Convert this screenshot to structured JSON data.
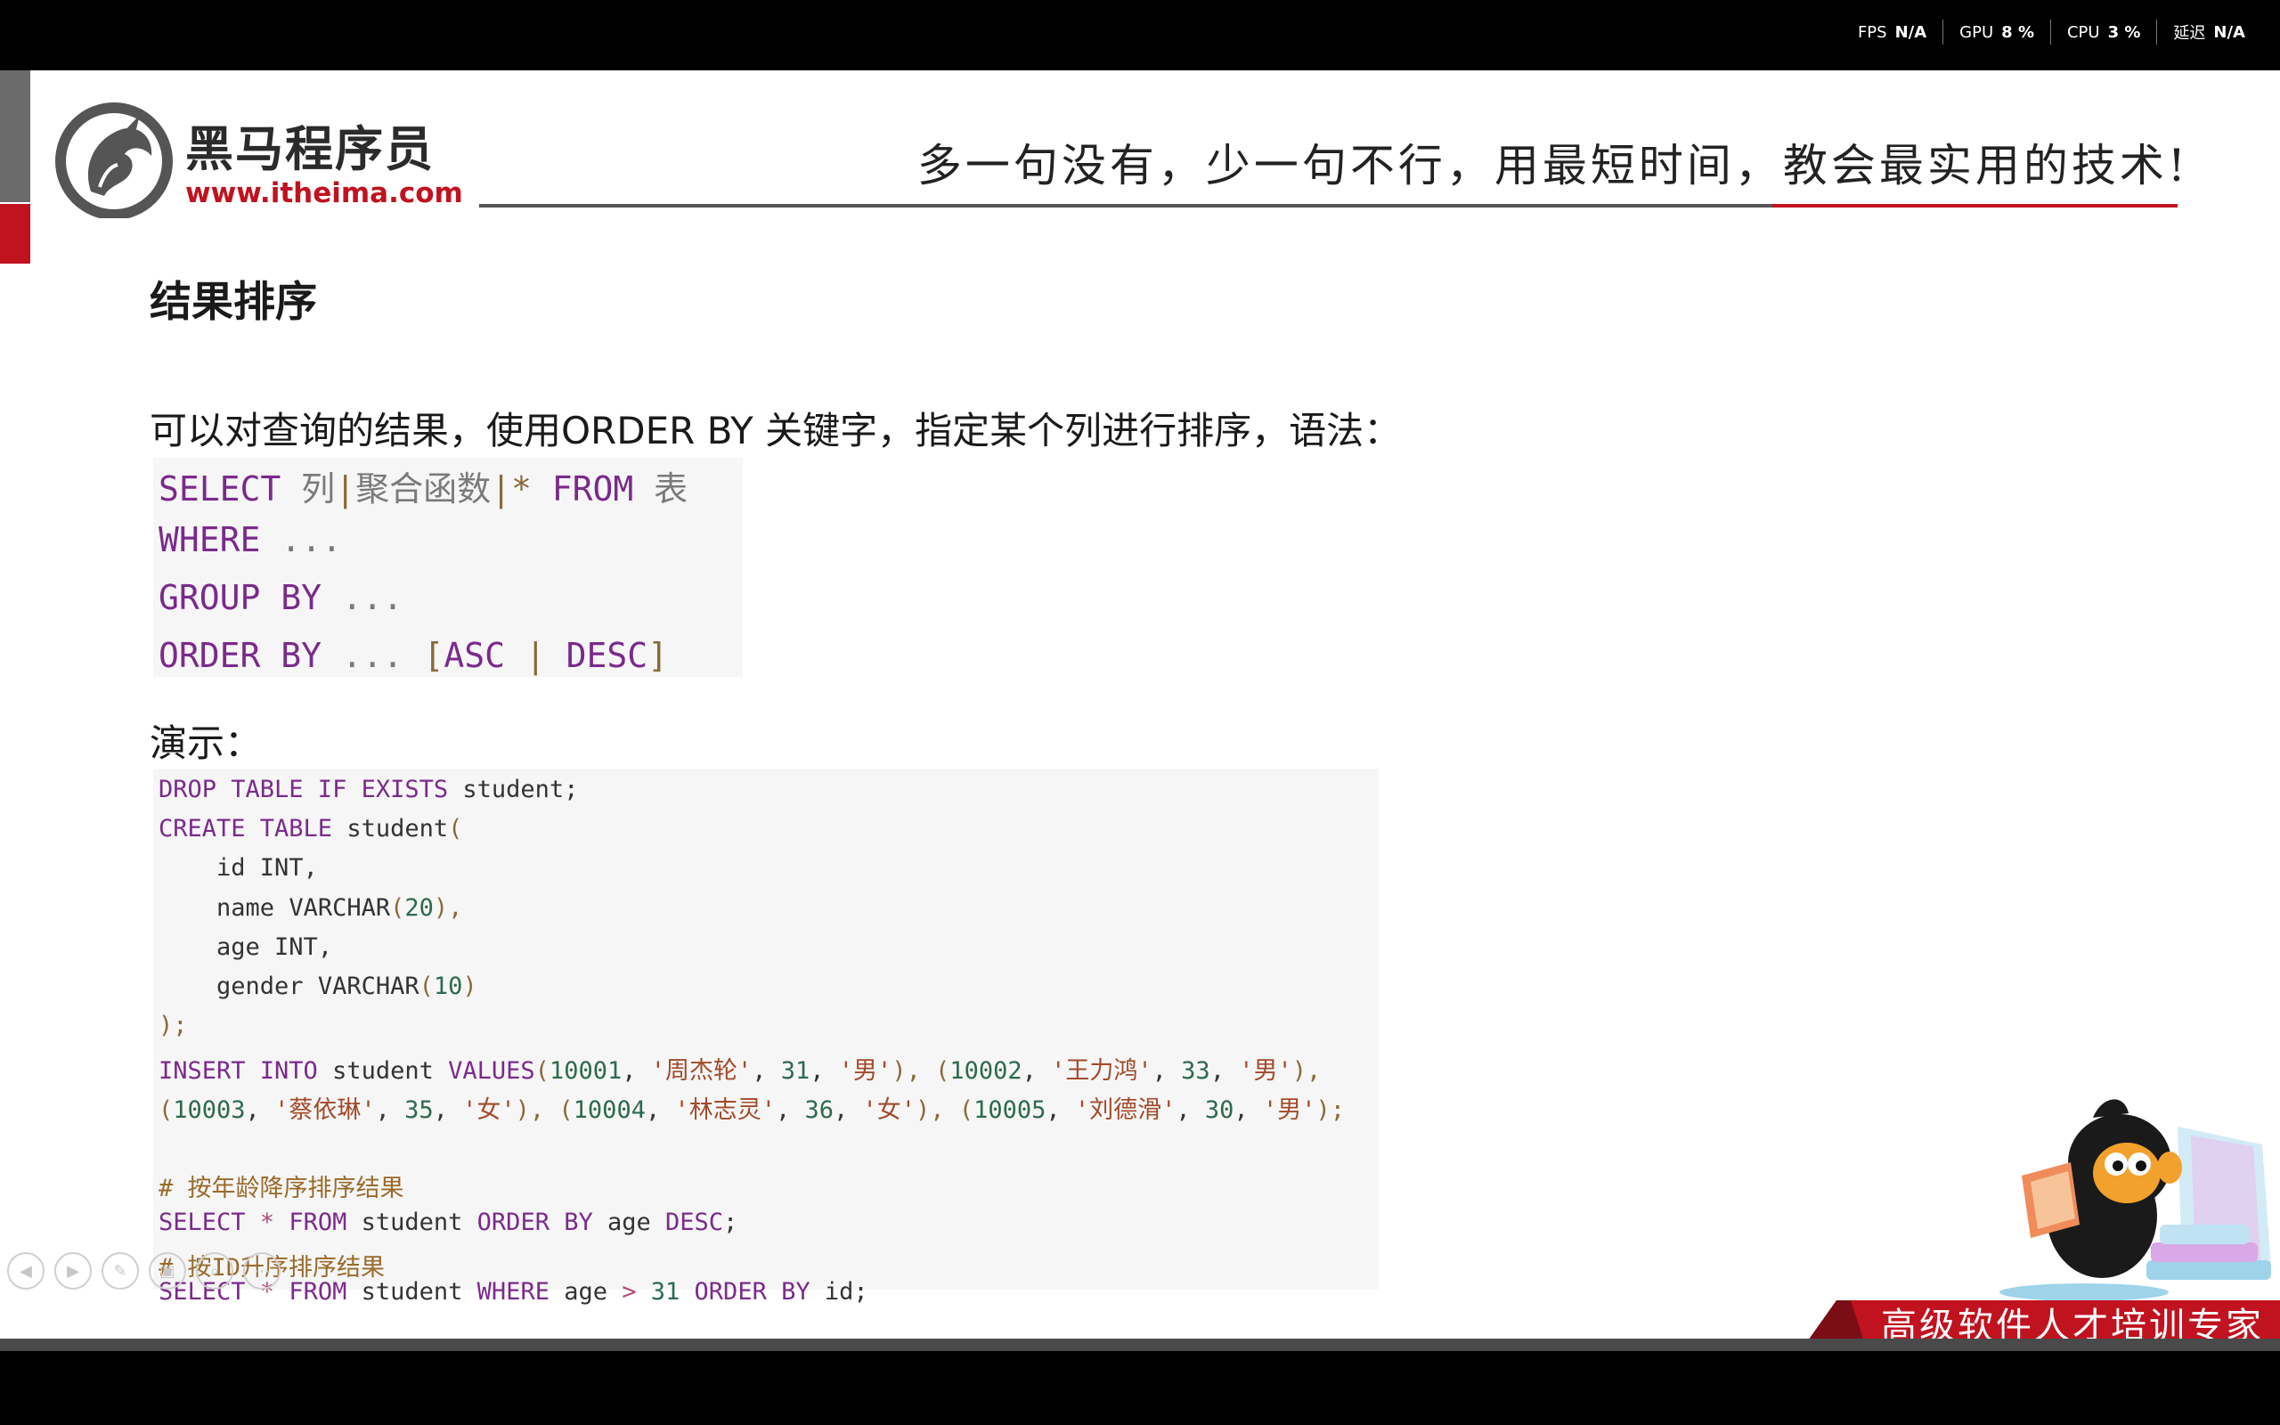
{
  "status_bar": {
    "stats": [
      {
        "label": "FPS",
        "value": "N/A"
      },
      {
        "label": "GPU",
        "value": "8 %"
      },
      {
        "label": "CPU",
        "value": "3 %"
      },
      {
        "label": "延迟",
        "value": "N/A"
      }
    ]
  },
  "header": {
    "logo_name": "黑马程序员",
    "logo_url": "www.itheima.com",
    "slogan": "多一句没有，少一句不行，用最短时间，教会最实用的技术!"
  },
  "slide": {
    "title": "结果排序",
    "intro": "可以对查询的结果，使用ORDER BY 关键字，指定某个列进行排序，语法：",
    "syntax": {
      "l1_select": "SELECT",
      "l1_col": "列",
      "l1_bar1": "|",
      "l1_agg": "聚合函数",
      "l1_bar2": "|",
      "l1_star": "*",
      "l1_from": "FROM",
      "l1_table": "表",
      "l2_where": "WHERE",
      "l2_rest": "...",
      "l3_group": "GROUP BY",
      "l3_rest": "...",
      "l4_order": "ORDER BY",
      "l4_dots": "...",
      "l4_open": "[",
      "l4_asc": "ASC",
      "l4_bar": "|",
      "l4_desc": "DESC",
      "l4_close": "]"
    },
    "demo_label": "演示：",
    "code": {
      "l1": [
        "DROP TABLE IF EXISTS",
        " student;"
      ],
      "l2": [
        "CREATE TABLE",
        " student",
        "("
      ],
      "l3": [
        "    id ",
        "INT",
        ","
      ],
      "l4": [
        "    name ",
        "VARCHAR",
        "(",
        "20",
        "),"
      ],
      "l5": [
        "    age ",
        "INT",
        ","
      ],
      "l6": [
        "    gender ",
        "VARCHAR",
        "(",
        "10",
        ")"
      ],
      "l7": [
        ");"
      ],
      "l8": [
        "INSERT INTO",
        " student ",
        "VALUES",
        "(",
        "10001",
        ", ",
        "'周杰轮'",
        ", ",
        "31",
        ", ",
        "'男'",
        "), (",
        "10002",
        ", ",
        "'王力鸿'",
        ", ",
        "33",
        ", ",
        "'男'",
        "),"
      ],
      "l9": [
        "(",
        "10003",
        ", ",
        "'蔡依琳'",
        ", ",
        "35",
        ", ",
        "'女'",
        "), (",
        "10004",
        ", ",
        "'林志灵'",
        ", ",
        "36",
        ", ",
        "'女'",
        "), (",
        "10005",
        ", ",
        "'刘德滑'",
        ", ",
        "30",
        ", ",
        "'男'",
        ");"
      ],
      "l10": [
        "# 按年龄降序排序结果"
      ],
      "l11": [
        "SELECT",
        " * ",
        "FROM",
        " student ",
        "ORDER BY",
        " age ",
        "DESC",
        ";"
      ],
      "l12": [
        "# 按ID升序排序结果"
      ],
      "l13": [
        "SELECT",
        " * ",
        "FROM",
        " student ",
        "WHERE",
        " age ",
        ">",
        " ",
        "31",
        " ",
        "ORDER BY",
        " id;"
      ]
    },
    "banner": "高级软件人才培训专家"
  },
  "controls": [
    "previous",
    "next",
    "pen",
    "slides",
    "zoom",
    "more"
  ]
}
